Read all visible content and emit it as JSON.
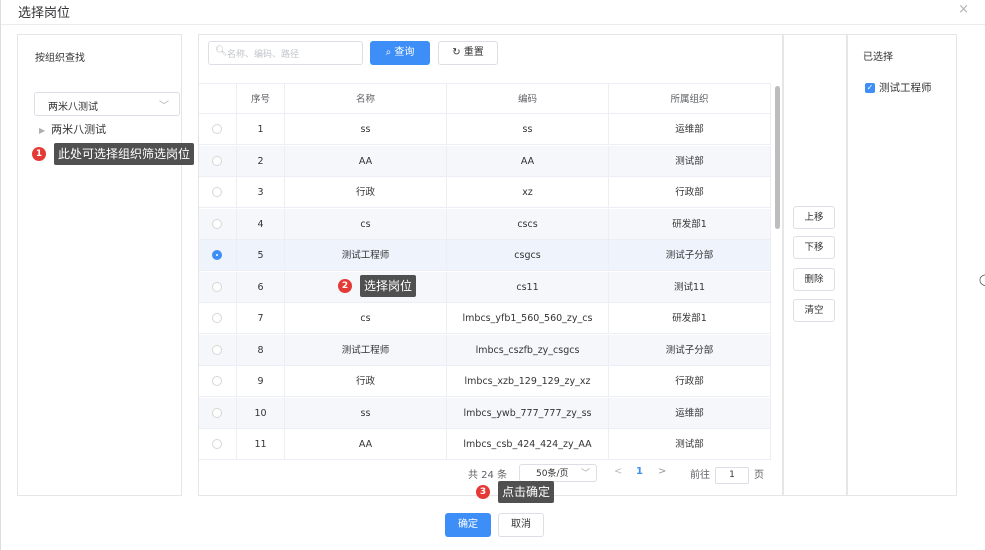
{
  "dialog": {
    "title": "选择岗位",
    "close": "×"
  },
  "org_panel": {
    "title": "按组织查找",
    "select_value": "两米八测试",
    "tree_node": "两米八测试"
  },
  "toolbar": {
    "search_placeholder": "名称、编码、路径",
    "query_label": "查询",
    "reset_label": "重置"
  },
  "table": {
    "headers": [
      "",
      "序号",
      "名称",
      "编码",
      "所属组织"
    ],
    "rows": [
      {
        "no": "1",
        "name": "ss",
        "code": "ss",
        "org": "运维部",
        "selected": false
      },
      {
        "no": "2",
        "name": "AA",
        "code": "AA",
        "org": "测试部",
        "selected": false
      },
      {
        "no": "3",
        "name": "行政",
        "code": "xz",
        "org": "行政部",
        "selected": false
      },
      {
        "no": "4",
        "name": "cs",
        "code": "cscs",
        "org": "研发部1",
        "selected": false
      },
      {
        "no": "5",
        "name": "测试工程师",
        "code": "csgcs",
        "org": "测试子分部",
        "selected": true
      },
      {
        "no": "6",
        "name": "",
        "code": "cs11",
        "org": "测试11",
        "selected": false
      },
      {
        "no": "7",
        "name": "cs",
        "code": "lmbcs_yfb1_560_560_zy_cs",
        "org": "研发部1",
        "selected": false
      },
      {
        "no": "8",
        "name": "测试工程师",
        "code": "lmbcs_cszfb_zy_csgcs",
        "org": "测试子分部",
        "selected": false
      },
      {
        "no": "9",
        "name": "行政",
        "code": "lmbcs_xzb_129_129_zy_xz",
        "org": "行政部",
        "selected": false
      },
      {
        "no": "10",
        "name": "ss",
        "code": "lmbcs_ywb_777_777_zy_ss",
        "org": "运维部",
        "selected": false
      },
      {
        "no": "11",
        "name": "AA",
        "code": "lmbcs_csb_424_424_zy_AA",
        "org": "测试部",
        "selected": false
      }
    ]
  },
  "pager": {
    "total": "共 24 条",
    "page_size": "50条/页",
    "prev": "<",
    "current": "1",
    "next": ">",
    "goto": "前往",
    "goto_value": "1",
    "page_unit": "页"
  },
  "side_buttons": {
    "up": "上移",
    "down": "下移",
    "delete": "删除",
    "clear": "清空"
  },
  "selected_panel": {
    "title": "已选择",
    "items": [
      "测试工程师"
    ]
  },
  "footer": {
    "ok": "确定",
    "cancel": "取消"
  },
  "annotations": [
    {
      "num": "1",
      "text": "此处可选择组织筛选岗位"
    },
    {
      "num": "2",
      "text": "选择岗位"
    },
    {
      "num": "3",
      "text": "点击确定"
    }
  ],
  "colors": {
    "primary": "#3e8ef7",
    "badge": "#e53935",
    "tooltip": "#505050"
  }
}
